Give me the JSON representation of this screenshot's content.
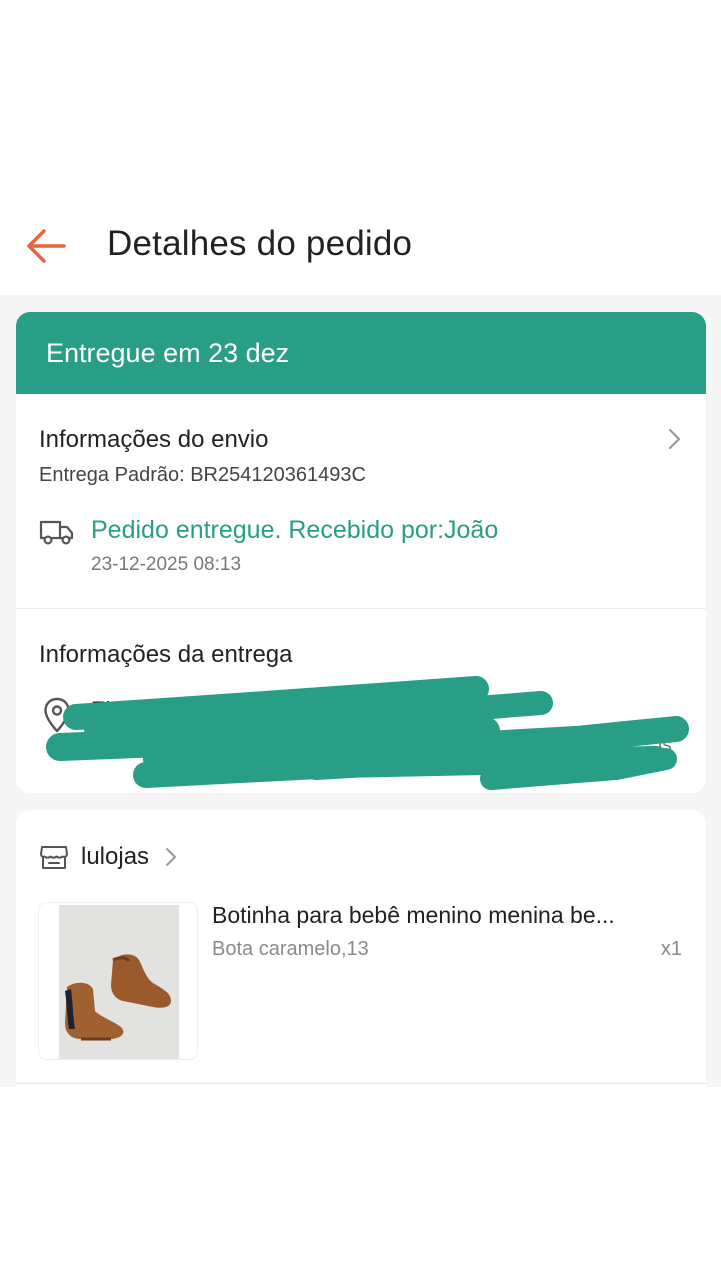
{
  "header": {
    "title": "Detalhes do pedido",
    "back_icon": "arrow-left-icon",
    "accent_color": "#e8643c"
  },
  "status_banner": {
    "text": "Entregue em 23 dez",
    "color": "#279e85"
  },
  "shipping": {
    "title": "Informações do envio",
    "tracking": "Entrega Padrão: BR254120361493C",
    "status": "Pedido entregue. Recebido por:João",
    "timestamp": "23-12-2025 08:13",
    "icons": [
      "truck-icon",
      "chevron-right-icon"
    ]
  },
  "delivery": {
    "title": "Informações da entrega",
    "name_partial": "El",
    "address_partial": "is",
    "icon": "location-pin-icon"
  },
  "store": {
    "name": "lulojas",
    "icons": [
      "store-icon",
      "chevron-right-icon"
    ]
  },
  "product": {
    "name": "Botinha para bebê menino menina be...",
    "variant": "Bota caramelo,13",
    "quantity": "x1"
  }
}
